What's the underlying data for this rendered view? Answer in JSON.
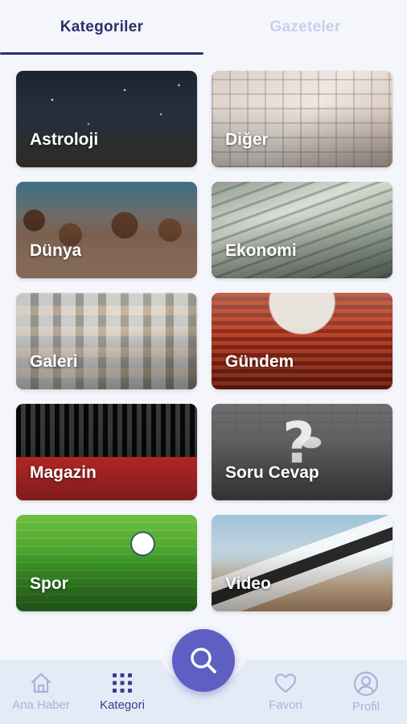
{
  "tabs": [
    {
      "label": "Kategoriler",
      "active": true
    },
    {
      "label": "Gazeteler",
      "active": false
    }
  ],
  "categories": [
    {
      "label": "Astroloji"
    },
    {
      "label": "Diğer"
    },
    {
      "label": "Dünya"
    },
    {
      "label": "Ekonomi"
    },
    {
      "label": "Galeri"
    },
    {
      "label": "Gündem"
    },
    {
      "label": "Magazin"
    },
    {
      "label": "Soru Cevap"
    },
    {
      "label": "Spor"
    },
    {
      "label": "Video"
    }
  ],
  "bottom_nav": {
    "items": [
      {
        "label": "Ana Haber",
        "icon": "home-icon",
        "active": false
      },
      {
        "label": "Kategori",
        "icon": "grid-icon",
        "active": true
      },
      {
        "label": "Favori",
        "icon": "heart-icon",
        "active": false
      },
      {
        "label": "Profil",
        "icon": "user-icon",
        "active": false
      }
    ],
    "search_icon": "search-icon"
  },
  "colors": {
    "accent": "#5d5fc2",
    "active_tab": "#2e2f6b",
    "inactive_tab": "#c7d0ec",
    "nav_background": "#e3ebf7",
    "page_background": "#f4f6fb"
  }
}
